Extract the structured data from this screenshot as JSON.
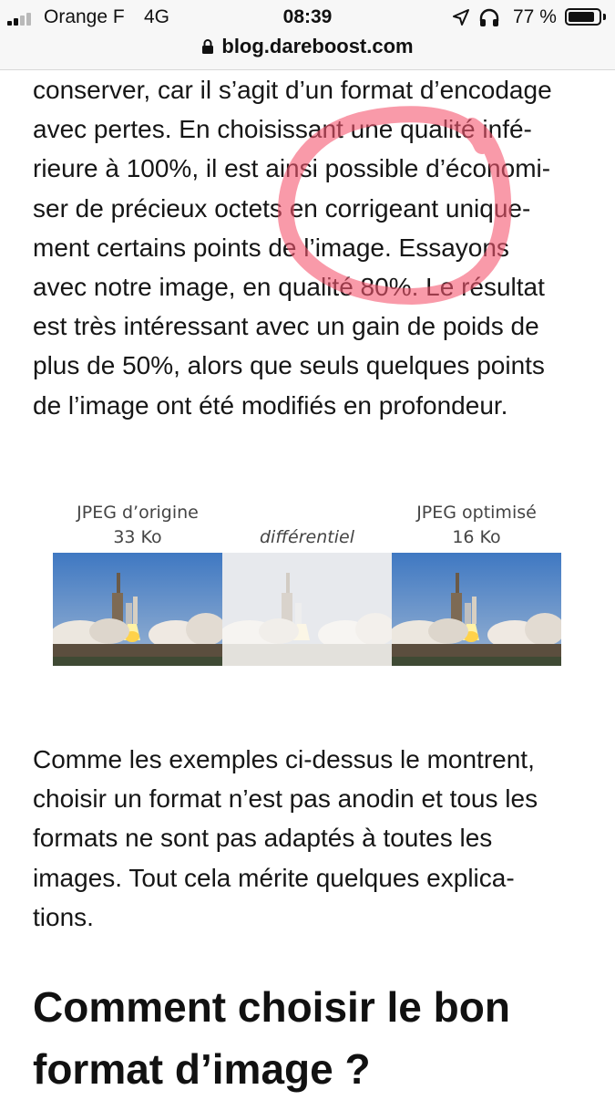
{
  "status_bar": {
    "carrier": "Orange F",
    "network": "4G",
    "time": "08:39",
    "battery": "77 %",
    "icons": [
      "signal-icon",
      "location-arrow-icon",
      "headphones-icon",
      "battery-icon"
    ]
  },
  "browser": {
    "url": "blog.dareboost.com",
    "icons": [
      "lock-icon"
    ]
  },
  "article": {
    "paragraph1_lines": [
      "conserver, car il s’agit d’un format d’encodage",
      "avec pertes. En choisissant une qualité infé-",
      "rieure à 100%, il est ainsi possible d’économi-",
      "ser de précieux octets en corrigeant unique-",
      "ment certains points de l’image. Essayons",
      "avec notre image, en qualité 80%. Le résultat",
      "est très intéressant avec un gain de poids de",
      "plus de 50%, alors que seuls quelques points",
      "de l’image ont été modifiés en profondeur."
    ],
    "figure": {
      "left_caption_line1": "JPEG d’origine",
      "left_caption_line2": "33 Ko",
      "middle_caption": "différentiel",
      "right_caption_line1": "JPEG optimisé",
      "right_caption_line2": "16 Ko"
    },
    "paragraph2_lines": [
      "Comme les exemples ci-dessus le montrent,",
      "choisir un format n’est pas anodin et tous les",
      "formats ne sont pas adaptés à toutes les",
      "images. Tout cela mérite quelques explica-",
      "tions."
    ],
    "heading_lines": [
      "Comment choisir le bon",
      "format d’image ?"
    ]
  },
  "colors": {
    "highlight_stroke": "#f5566f"
  }
}
